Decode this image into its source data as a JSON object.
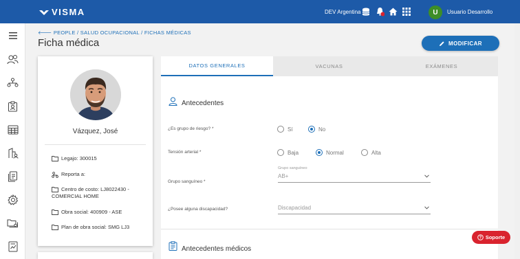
{
  "header": {
    "logo_text": "VISMA",
    "environment": "DEV Argentina",
    "user_initial": "U",
    "user_name": "Usuario Desarrollo",
    "notification_count": "9+",
    "brand_color": "#1d5aa8"
  },
  "sidebar": {
    "icons": [
      "menu-icon",
      "people-icon",
      "organization-icon",
      "badge-icon",
      "calendar-grid-icon",
      "building-person-icon",
      "documents-icon",
      "settings-icon",
      "folders-icon",
      "report-icon"
    ]
  },
  "page": {
    "breadcrumb": "PEOPLE / SALUD OCUPACIONAL / FICHAS MÉDICAS",
    "title": "Ficha médica",
    "modify_label": "MODIFICAR"
  },
  "profile": {
    "name": "Vázquez, José",
    "legajo": "Legajo: 300015",
    "reporta": "Reporta a:",
    "centro_costo_1": "Centro de costo:  LJ8022430 -",
    "centro_costo_2": "COMERCIAL  HOME",
    "obra_social": "Obra social:  400909 - ASE",
    "plan": "Plan de obra social:  SMG LJ3"
  },
  "tabs": [
    {
      "label": "DATOS GENERALES",
      "active": true
    },
    {
      "label": "VACUNAS",
      "active": false
    },
    {
      "label": "EXÁMENES",
      "active": false
    }
  ],
  "antecedentes": {
    "title": "Antecedentes",
    "grupo_riesgo_label": "¿Es grupo de riesgo? *",
    "grupo_riesgo_options": [
      "Sí",
      "No"
    ],
    "grupo_riesgo_selected": "No",
    "tension_label": "Tensión arterial *",
    "tension_options": [
      "Baja",
      "Normal",
      "Alta"
    ],
    "tension_selected": "Normal",
    "grupo_sanguineo_label": "Grupo sanguíneo *",
    "grupo_sanguineo_float": "Grupo sanguíneo",
    "grupo_sanguineo_value": "AB+",
    "discapacidad_label": "¿Posee alguna discapacidad?",
    "discapacidad_placeholder": "Discapacidad"
  },
  "antecedentes_medicos": {
    "title": "Antecedentes médicos"
  },
  "support": {
    "label": "Soporte"
  }
}
